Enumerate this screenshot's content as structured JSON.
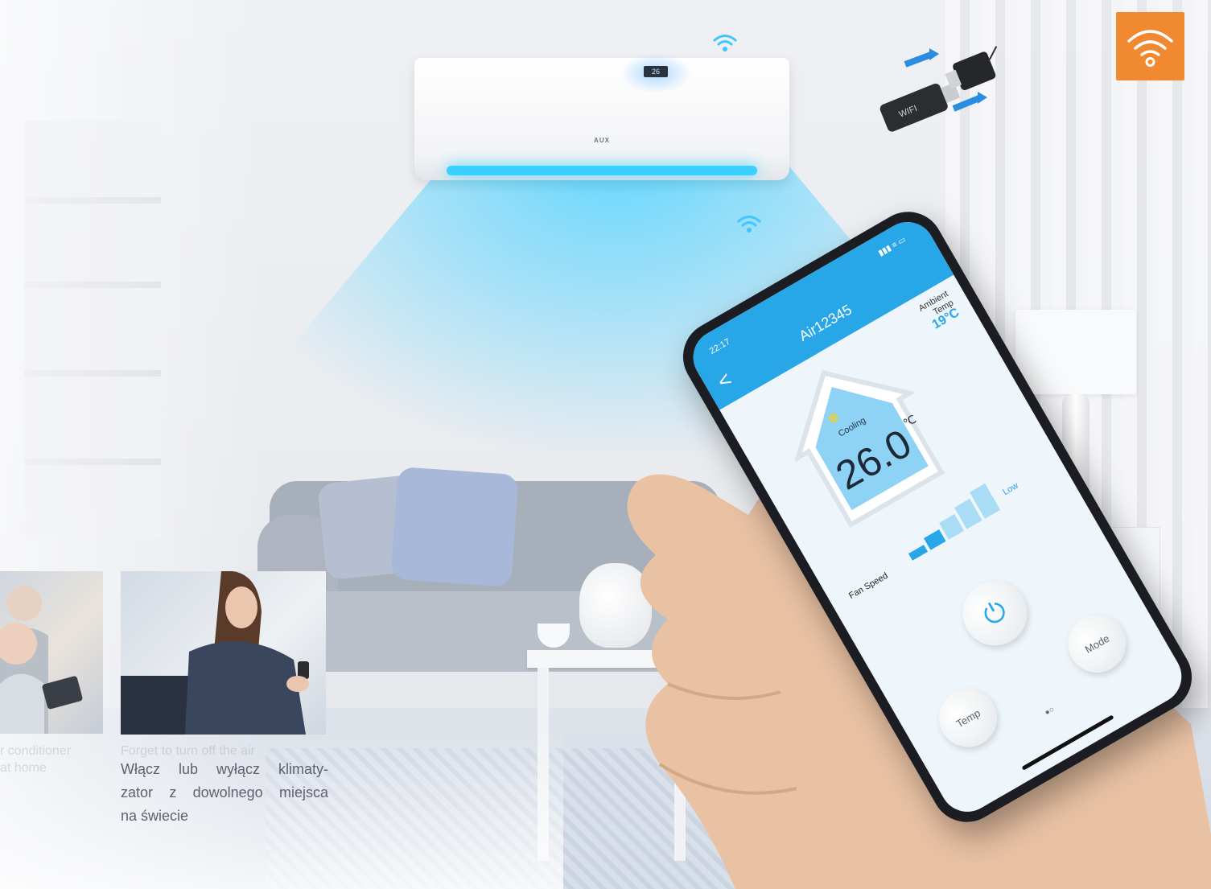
{
  "ac": {
    "brand": "AUX",
    "display": "26"
  },
  "badge": {
    "icon": "wifi-icon",
    "color": "#f0892f"
  },
  "dongle": {
    "label": "WIFI"
  },
  "app": {
    "status_time": "22:17",
    "status_icons": "▮▮▮ ≡ ▭",
    "back_label": "<",
    "title": "Air12345",
    "ambient_label_line1": "Ambient",
    "ambient_label_line2": "Temp",
    "ambient_value": "19°C",
    "mode_icon": "snowflake-icon",
    "mode_label": "Cooling",
    "set_temp": "26.0",
    "set_unit": "℃",
    "fan_label": "Fan Speed",
    "fan_level": "Low",
    "fan_bars": 5,
    "fan_active": 2,
    "power_label": "⏻",
    "temp_button": "Temp",
    "mode_button": "Mode",
    "page_dots": "●○",
    "accent": "#27a6e8"
  },
  "cards": {
    "left_caption_faint_line1": "r conditioner",
    "left_caption_faint_line2": "at home",
    "right_caption_faint": "Forget to turn off the air",
    "right_caption": "Włącz lub wyłącz klimaty-zator z dowolnego miejsca na świecie",
    "right_caption_line1": "Włącz lub wyłącz klimaty-",
    "right_caption_line2": "zator z dowolnego miejsca",
    "right_caption_line3": "na świecie"
  }
}
